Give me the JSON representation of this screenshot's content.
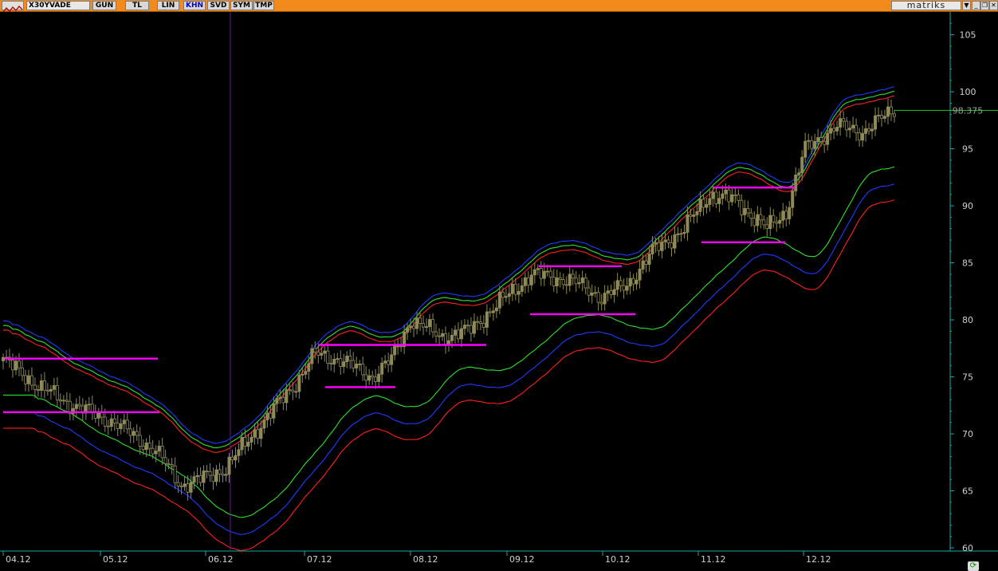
{
  "toolbar": {
    "symbol": "X30YVADE",
    "period_buttons": [
      "GUN",
      "TL",
      "LIN",
      "KHN",
      "SVD",
      "SYM",
      "TMP"
    ],
    "active_button": "KHN",
    "brand": "matriks",
    "window_buttons": [
      "▼",
      "_",
      "❐",
      "✕"
    ]
  },
  "chart_data": {
    "type": "candlestick",
    "symbol": "X30YVADE",
    "last_value": "98.375",
    "ylim": [
      60,
      107
    ],
    "y_ticks": [
      60,
      65,
      70,
      75,
      80,
      85,
      90,
      95,
      100,
      105
    ],
    "x_ticks": [
      "04.12",
      "05.12",
      "06.12",
      "07.12",
      "08.12",
      "09.12",
      "10.12",
      "11.12",
      "12.12"
    ],
    "start_close": 76.5,
    "close_waypoints": [
      {
        "i": 0,
        "v": 76.5
      },
      {
        "i": 12,
        "v": 74.0
      },
      {
        "i": 22,
        "v": 72.5
      },
      {
        "i": 35,
        "v": 71.0
      },
      {
        "i": 48,
        "v": 68.5
      },
      {
        "i": 56,
        "v": 65.5
      },
      {
        "i": 62,
        "v": 66.0
      },
      {
        "i": 70,
        "v": 67.0
      },
      {
        "i": 80,
        "v": 70.5
      },
      {
        "i": 92,
        "v": 74.5
      },
      {
        "i": 98,
        "v": 77.0
      },
      {
        "i": 106,
        "v": 76.5
      },
      {
        "i": 116,
        "v": 75.0
      },
      {
        "i": 122,
        "v": 76.5
      },
      {
        "i": 128,
        "v": 80.0
      },
      {
        "i": 138,
        "v": 78.5
      },
      {
        "i": 146,
        "v": 79.0
      },
      {
        "i": 156,
        "v": 81.5
      },
      {
        "i": 166,
        "v": 84.0
      },
      {
        "i": 178,
        "v": 83.5
      },
      {
        "i": 188,
        "v": 82.0
      },
      {
        "i": 196,
        "v": 83.0
      },
      {
        "i": 204,
        "v": 86.0
      },
      {
        "i": 214,
        "v": 88.0
      },
      {
        "i": 222,
        "v": 91.0
      },
      {
        "i": 230,
        "v": 90.5
      },
      {
        "i": 240,
        "v": 88.0
      },
      {
        "i": 246,
        "v": 89.5
      },
      {
        "i": 252,
        "v": 95.0
      },
      {
        "i": 262,
        "v": 97.0
      },
      {
        "i": 270,
        "v": 96.5
      },
      {
        "i": 280,
        "v": 98.4
      }
    ],
    "n_bars": 281,
    "bands": {
      "upper_blue": "#1f3cff",
      "upper_green": "#2de02d",
      "upper_red": "#ff2020",
      "lower_green": "#2de02d",
      "lower_blue": "#1f3cff",
      "lower_red": "#ff2020"
    },
    "candle_color": "#8f8a58",
    "vertical_marker_color": "#6a1a8a",
    "level_line_color": "#ff00ff",
    "last_price_line_color": "#22cc22",
    "level_lines": [
      {
        "x_from": "04.12",
        "x_to": "05.12",
        "value": 76.6
      },
      {
        "x_from": "04.12",
        "x_to": "05.12",
        "value": 71.9
      },
      {
        "x_from": "07.12",
        "x_to": "08.12",
        "value": 77.8
      },
      {
        "x_from": "07.12",
        "x_to": "08.12",
        "value": 74.1
      },
      {
        "x_from": "09.12",
        "x_to": "10.12",
        "value": 84.7
      },
      {
        "x_from": "09.12",
        "x_to": "10.12",
        "value": 80.5
      },
      {
        "x_from": "11.12",
        "x_to": "12.12",
        "value": 91.6
      },
      {
        "x_from": "11.12",
        "x_to": "12.12",
        "value": 86.8
      }
    ]
  }
}
